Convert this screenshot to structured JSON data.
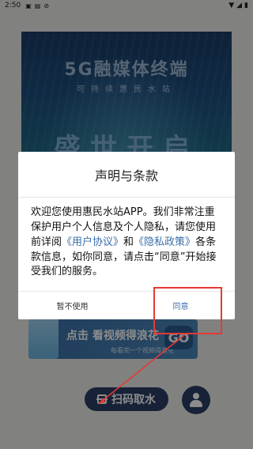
{
  "status_bar": {
    "time": "2:50",
    "icons_left": [
      "image-icon",
      "notification-icon",
      "block-icon"
    ],
    "icons_right": [
      "wifi-icon",
      "signal-icon",
      "battery-icon"
    ]
  },
  "banner": {
    "title": "5G融媒体终端",
    "subtitle": "可持续惠民水站",
    "slogan": "盛世开启"
  },
  "promo": {
    "text": "点击 看视频得浪花",
    "subtext": "每看完一个视频得浪花",
    "go_label": "GO"
  },
  "bottom": {
    "scan_label": "扫码取水"
  },
  "dialog": {
    "title": "声明与条款",
    "body_part1": "欢迎您使用惠民水站APP。我们非常注重保护用户个人信息及个人隐私，请您使用前详阅",
    "link_user_agreement": "《用户协议》",
    "body_and": "和",
    "link_privacy": "《隐私政策》",
    "body_part2": "各条款信息，如你同意，请点击“同意”开始接受我们的服务。",
    "decline_label": "暂不使用",
    "agree_label": "同意"
  },
  "colors": {
    "accent_blue": "#3b6ea8",
    "button_navy": "#2a3f66",
    "annotation_red": "#e53935"
  }
}
